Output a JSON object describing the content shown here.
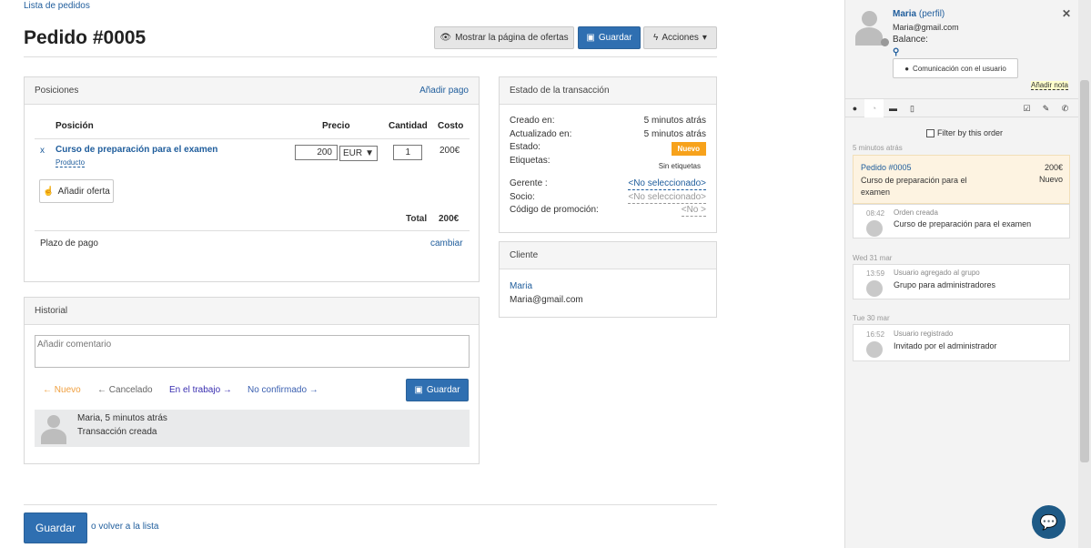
{
  "breadcrumb": "Lista de pedidos",
  "title": "Pedido #0005",
  "toolbar": {
    "show_offers": "Mostrar la página de ofertas",
    "save": "Guardar",
    "actions": "Acciones"
  },
  "positions": {
    "title": "Posiciones",
    "add_payment": "Añadir pago",
    "col_position": "Posición",
    "col_price": "Precio",
    "col_qty": "Cantidad",
    "col_cost": "Costo",
    "item_remove": "x",
    "item_name": "Curso de preparación para el examen",
    "item_type": "Producto",
    "item_price": "200",
    "item_currency": "EUR",
    "item_qty": "1",
    "item_cost": "200€",
    "add_offer": "Añadir oferta",
    "total_label": "Total",
    "total_value": "200€",
    "payment_term": "Plazo de pago",
    "change": "cambiar"
  },
  "transaction": {
    "title": "Estado de la transacción",
    "created_label": "Creado en:",
    "created_value": "5 minutos atrás",
    "updated_label": "Actualizado en:",
    "updated_value": "5 minutos atrás",
    "status_label": "Estado:",
    "status_value": "Nuevo",
    "tags_label": "Etiquetas:",
    "tags_value": "Sin etiquetas",
    "manager_label": "Gerente :",
    "manager_value": "<No seleccionado>",
    "partner_label": "Socio:",
    "partner_value": "<No seleccionado>",
    "promo_label": "Código de promoción:",
    "promo_value": "<No >"
  },
  "client": {
    "title": "Cliente",
    "name": "Maria",
    "email": "Maria@gmail.com"
  },
  "history": {
    "title": "Historial",
    "comment_placeholder": "Añadir comentario",
    "states": [
      "Nuevo",
      "Cancelado",
      "En el trabajo",
      "No confirmado"
    ],
    "save": "Guardar",
    "entry_author": "Maria, 5 minutos atrás",
    "entry_text": "Transacción creada"
  },
  "footer": {
    "save": "Guardar",
    "back_prefix": "o",
    "back": "volver a la lista"
  },
  "sidebar": {
    "user_name": "Maria",
    "profile": "(perfil)",
    "email": "Maria@gmail.com",
    "balance": "Balance:",
    "comm_button": "Comunicación con el usuario",
    "add_note": "Añadir nota",
    "filter": "Filter by this order",
    "group1_time": "5 minutos atrás",
    "order_card": {
      "title": "Pedido #0005",
      "amount": "200€",
      "desc": "Curso de preparación para el examen",
      "status": "Nuevo"
    },
    "event1": {
      "time": "08:42",
      "title": "Orden creada",
      "text": "Curso de preparación para el examen"
    },
    "group2_time": "Wed 31 mar",
    "event2": {
      "time": "13:59",
      "title": "Usuario agregado al grupo",
      "text": "Grupo para administradores"
    },
    "group3_time": "Tue 30 mar",
    "event3": {
      "time": "16:52",
      "title": "Usuario registrado",
      "text": "Invitado por el administrador"
    }
  },
  "colors": {
    "accent": "#2f6fb1",
    "link": "#1f5d9c",
    "new_badge": "#f7a21b",
    "new_state": "#f0a040"
  }
}
